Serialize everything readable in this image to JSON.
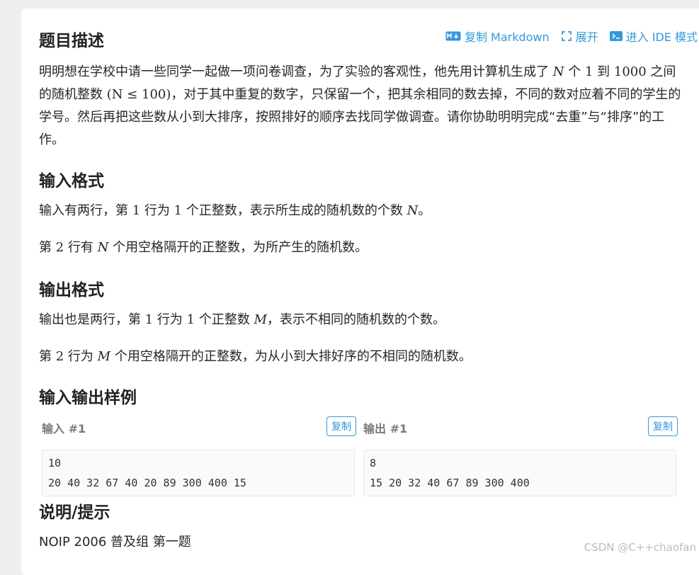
{
  "title": "题目描述",
  "actions": {
    "copy_markdown": "复制 Markdown",
    "expand": "展开",
    "ide": "进入 IDE 模式"
  },
  "description": {
    "p1": "明明想在学校中请一些同学一起做一项问卷调查，为了实验的客观性，他先用计算机生成了",
    "v1": "N",
    "p2": "个",
    "n1": "1",
    "p3": "到",
    "n2": "1000",
    "p4": "之间的随机整数",
    "expr": "(N ≤ 100)",
    "p5": "，对于其中重复的数字，只保留一个，把其余相同的数去掉，不同的数对应着不同的学生的学号。然后再把这些数从小到大排序，按照排好的顺序去找同学做调查。请你协助明明完成“去重”与“排序”的工作。"
  },
  "input_format": {
    "title": "输入格式",
    "l1a": "输入有两行，第",
    "l1n1": "1",
    "l1b": "行为",
    "l1n2": "1",
    "l1c": "个正整数，表示所生成的随机数的个数",
    "l1v": "N",
    "l1d": "。",
    "l2a": "第",
    "l2n": "2",
    "l2b": "行有",
    "l2v": "N",
    "l2c": "个用空格隔开的正整数，为所产生的随机数。"
  },
  "output_format": {
    "title": "输出格式",
    "l1a": "输出也是两行，第",
    "l1n1": "1",
    "l1b": "行为",
    "l1n2": "1",
    "l1c": "个正整数",
    "l1v": "M",
    "l1d": "，表示不相同的随机数的个数。",
    "l2a": "第",
    "l2n": "2",
    "l2b": "行为",
    "l2v": "M",
    "l2c": "个用空格隔开的正整数，为从小到大排好序的不相同的随机数。"
  },
  "samples": {
    "title": "输入输出样例",
    "input": {
      "label": "输入 #1",
      "copy": "复制",
      "lines": [
        "10",
        "20 40 32 67 40 20 89 300 400 15"
      ]
    },
    "output": {
      "label": "输出 #1",
      "copy": "复制",
      "lines": [
        "8",
        "15 20 32 40 67 89 300 400"
      ]
    }
  },
  "hint": {
    "title": "说明/提示",
    "text": "NOIP 2006 普及组 第一题"
  },
  "watermark": "CSDN @C++chaofan",
  "colors": {
    "accent": "#3498db",
    "background": "#efefef",
    "card": "#ffffff"
  }
}
